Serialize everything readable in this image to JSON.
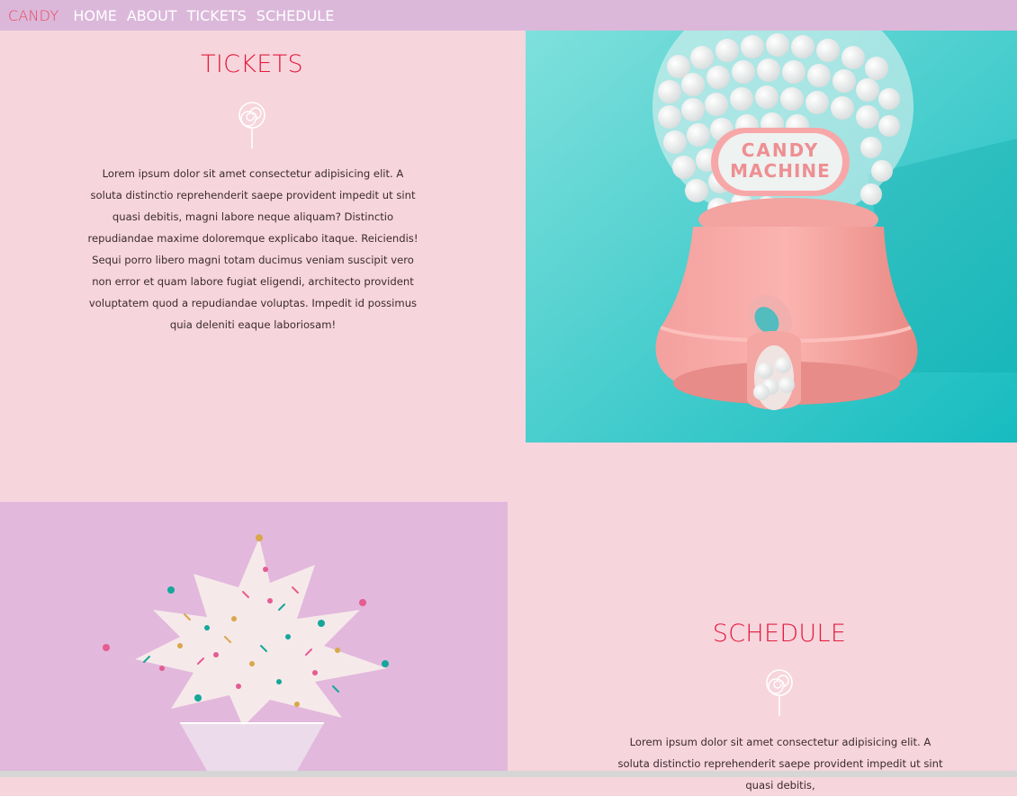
{
  "nav": {
    "brand": "CANDY",
    "links": [
      "HOME",
      "ABOUT",
      "TICKETS",
      "SCHEDULE"
    ]
  },
  "tickets": {
    "title": "TICKETS",
    "text": "Lorem ipsum dolor sit amet consectetur adipisicing elit. A soluta distinctio reprehenderit saepe provident impedit ut sint quasi debitis, magni labore neque aliquam? Distinctio repudiandae maxime doloremque explicabo itaque. Reiciendis! Sequi porro libero magni totam ducimus veniam suscipit vero non error et quam labore fugiat eligendi, architecto provident voluptatem quod a repudiandae voluptas. Impedit id possimus quia deleniti eaque laboriosam!"
  },
  "candy_machine_image": {
    "label_line1": "CANDY",
    "label_line2": "MACHINE"
  },
  "schedule": {
    "title": "SCHEDULE",
    "text": "Lorem ipsum dolor sit amet consectetur adipisicing elit. A soluta distinctio reprehenderit saepe provident impedit ut sint quasi debitis,"
  },
  "colors": {
    "nav_bg": "#dbb8da",
    "page_bg": "#f7d5dd",
    "accent": "#e31c3d",
    "teal": "#3fcfcf",
    "lilac": "#e2b8dc"
  }
}
